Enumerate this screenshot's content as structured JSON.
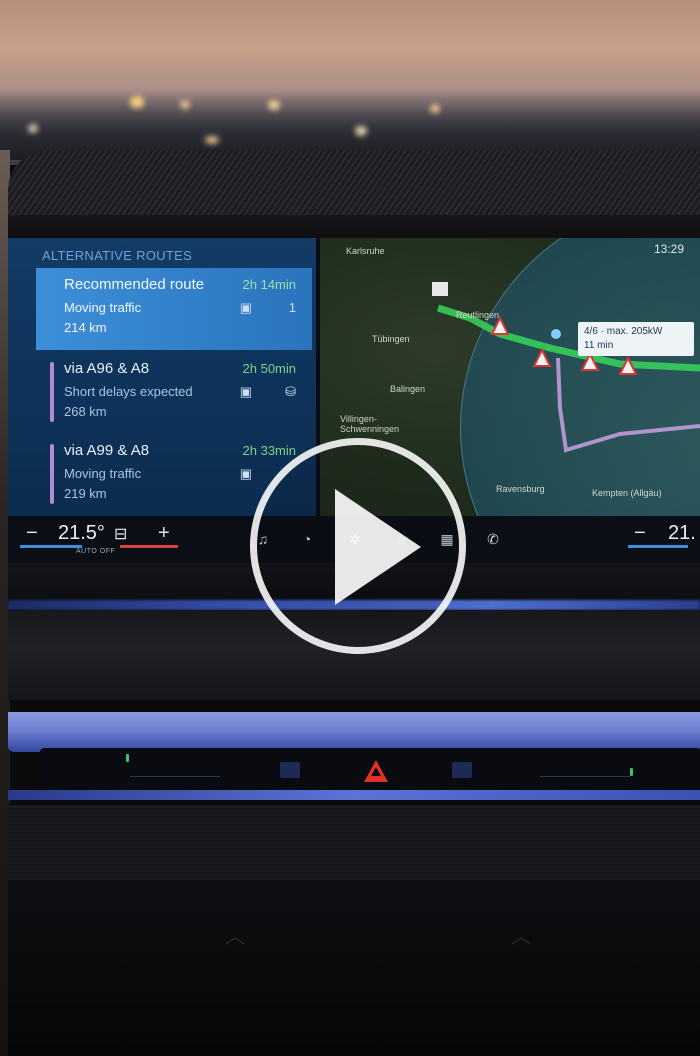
{
  "navigation": {
    "panel_title": "ALTERNATIVE ROUTES",
    "routes": [
      {
        "name": "Recommended route",
        "time": "2h 14min",
        "status": "Moving traffic",
        "distance": "214 km",
        "count": "1",
        "selected": true
      },
      {
        "name": "via A96 & A8",
        "time": "2h 50min",
        "status": "Short delays expected",
        "distance": "268 km",
        "selected": false
      },
      {
        "name": "via A99 & A8",
        "time": "2h 33min",
        "status": "Moving traffic",
        "distance": "219 km",
        "selected": false
      }
    ]
  },
  "map": {
    "clock": "13:29",
    "charging_info_line1": "4/6 · max. 205kW",
    "charging_info_line2": "11 min",
    "labels": [
      "Karlsruhe",
      "Reutlingen",
      "Tübingen",
      "Balingen",
      "Villingen-Schwenningen",
      "Ravensburg",
      "Kempten (Allgäu)"
    ]
  },
  "climate": {
    "left_temp": "21.5°",
    "left_mode": "AUTO OFF",
    "right_temp": "21.",
    "minus_label": "−",
    "plus_label": "+"
  },
  "colors": {
    "route_panel": "#0e3259",
    "route_selected": "#3d8fd9",
    "route_time_green": "#7ed18a",
    "map_route_green": "#38d65a",
    "map_route_purple": "#c9a0e0",
    "ambient_blue": "#5b74d6",
    "hazard_red": "#e0302a"
  },
  "icons": {
    "play": "play-icon",
    "hazard": "hazard-warning-icon",
    "home": "home-icon"
  }
}
